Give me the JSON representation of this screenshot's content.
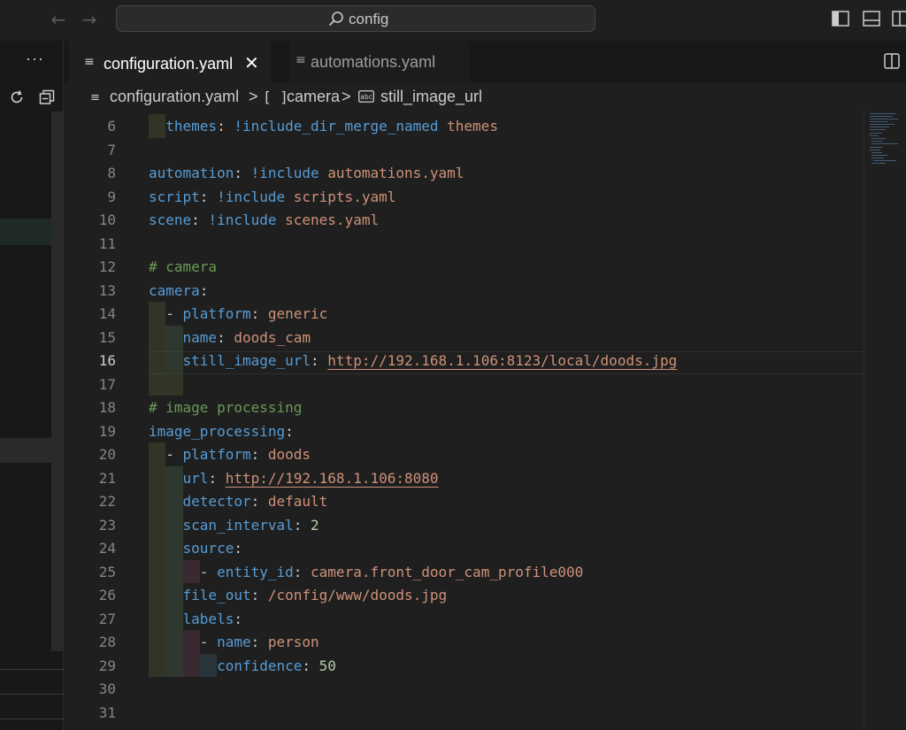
{
  "titlebar": {
    "search_text": "config",
    "back_icon": "arrow-left-icon",
    "forward_icon": "arrow-right-icon"
  },
  "sidebar": {
    "more_label": "···"
  },
  "tabs": [
    {
      "label": "configuration.yaml",
      "active": true,
      "icon": "file-lines-icon"
    },
    {
      "label": "automations.yaml",
      "active": false,
      "icon": "file-lines-icon"
    }
  ],
  "breadcrumb": {
    "file": "configuration.yaml",
    "sep1": ">",
    "bracket_icon": "[ ]",
    "section": "camera",
    "sep2": ">",
    "field": "still_image_url"
  },
  "editor": {
    "active_line": "16",
    "lines": [
      {
        "num": "6",
        "tokens": [
          {
            "t": "  ",
            "c": "w"
          },
          {
            "t": "themes",
            "c": "k"
          },
          {
            "t": ": ",
            "c": "w"
          },
          {
            "t": "!include_dir_merge_named",
            "c": "k"
          },
          {
            "t": " themes",
            "c": "s"
          }
        ]
      },
      {
        "num": "7",
        "tokens": []
      },
      {
        "num": "8",
        "tokens": [
          {
            "t": "automation",
            "c": "k"
          },
          {
            "t": ": ",
            "c": "w"
          },
          {
            "t": "!include",
            "c": "k"
          },
          {
            "t": " automations.yaml",
            "c": "s"
          }
        ]
      },
      {
        "num": "9",
        "tokens": [
          {
            "t": "script",
            "c": "k"
          },
          {
            "t": ": ",
            "c": "w"
          },
          {
            "t": "!include",
            "c": "k"
          },
          {
            "t": " scripts.yaml",
            "c": "s"
          }
        ]
      },
      {
        "num": "10",
        "tokens": [
          {
            "t": "scene",
            "c": "k"
          },
          {
            "t": ": ",
            "c": "w"
          },
          {
            "t": "!include",
            "c": "k"
          },
          {
            "t": " scenes.yaml",
            "c": "s"
          }
        ]
      },
      {
        "num": "11",
        "tokens": []
      },
      {
        "num": "12",
        "tokens": [
          {
            "t": "# camera",
            "c": "c"
          }
        ]
      },
      {
        "num": "13",
        "tokens": [
          {
            "t": "camera",
            "c": "k"
          },
          {
            "t": ":",
            "c": "w"
          }
        ]
      },
      {
        "num": "14",
        "tokens": [
          {
            "t": "  - ",
            "c": "w"
          },
          {
            "t": "platform",
            "c": "k"
          },
          {
            "t": ": ",
            "c": "w"
          },
          {
            "t": "generic",
            "c": "s"
          }
        ]
      },
      {
        "num": "15",
        "tokens": [
          {
            "t": "    ",
            "c": "w"
          },
          {
            "t": "name",
            "c": "k"
          },
          {
            "t": ": ",
            "c": "w"
          },
          {
            "t": "doods_cam",
            "c": "s"
          }
        ]
      },
      {
        "num": "16",
        "tokens": [
          {
            "t": "    ",
            "c": "w"
          },
          {
            "t": "still_image_url",
            "c": "k"
          },
          {
            "t": ": ",
            "c": "w"
          },
          {
            "t": "http://192.168.1.106:8123/local/doods.jpg",
            "c": "u"
          }
        ]
      },
      {
        "num": "17",
        "tokens": []
      },
      {
        "num": "18",
        "tokens": [
          {
            "t": "# image processing",
            "c": "c"
          }
        ]
      },
      {
        "num": "19",
        "tokens": [
          {
            "t": "image_processing",
            "c": "k"
          },
          {
            "t": ":",
            "c": "w"
          }
        ]
      },
      {
        "num": "20",
        "tokens": [
          {
            "t": "  - ",
            "c": "w"
          },
          {
            "t": "platform",
            "c": "k"
          },
          {
            "t": ": ",
            "c": "w"
          },
          {
            "t": "doods",
            "c": "s"
          }
        ]
      },
      {
        "num": "21",
        "tokens": [
          {
            "t": "    ",
            "c": "w"
          },
          {
            "t": "url",
            "c": "k"
          },
          {
            "t": ": ",
            "c": "w"
          },
          {
            "t": "http://192.168.1.106:8080",
            "c": "u"
          }
        ]
      },
      {
        "num": "22",
        "tokens": [
          {
            "t": "    ",
            "c": "w"
          },
          {
            "t": "detector",
            "c": "k"
          },
          {
            "t": ": ",
            "c": "w"
          },
          {
            "t": "default",
            "c": "s"
          }
        ]
      },
      {
        "num": "23",
        "tokens": [
          {
            "t": "    ",
            "c": "w"
          },
          {
            "t": "scan_interval",
            "c": "k"
          },
          {
            "t": ": ",
            "c": "w"
          },
          {
            "t": "2",
            "c": "n"
          }
        ]
      },
      {
        "num": "24",
        "tokens": [
          {
            "t": "    ",
            "c": "w"
          },
          {
            "t": "source",
            "c": "k"
          },
          {
            "t": ":",
            "c": "w"
          }
        ]
      },
      {
        "num": "25",
        "tokens": [
          {
            "t": "      - ",
            "c": "w"
          },
          {
            "t": "entity_id",
            "c": "k"
          },
          {
            "t": ": ",
            "c": "w"
          },
          {
            "t": "camera.front_door_cam_profile000",
            "c": "s"
          }
        ]
      },
      {
        "num": "26",
        "tokens": [
          {
            "t": "    ",
            "c": "w"
          },
          {
            "t": "file_out",
            "c": "k"
          },
          {
            "t": ": ",
            "c": "w"
          },
          {
            "t": "/config/www/doods.jpg",
            "c": "s"
          }
        ]
      },
      {
        "num": "27",
        "tokens": [
          {
            "t": "    ",
            "c": "w"
          },
          {
            "t": "labels",
            "c": "k"
          },
          {
            "t": ":",
            "c": "w"
          }
        ]
      },
      {
        "num": "28",
        "tokens": [
          {
            "t": "      - ",
            "c": "w"
          },
          {
            "t": "name",
            "c": "k"
          },
          {
            "t": ": ",
            "c": "w"
          },
          {
            "t": "person",
            "c": "s"
          }
        ]
      },
      {
        "num": "29",
        "tokens": [
          {
            "t": "        ",
            "c": "w"
          },
          {
            "t": "confidence",
            "c": "k"
          },
          {
            "t": ": ",
            "c": "w"
          },
          {
            "t": "50",
            "c": "n"
          }
        ]
      },
      {
        "num": "30",
        "tokens": []
      },
      {
        "num": "31",
        "tokens": []
      }
    ]
  },
  "colors": {
    "keyword": "#569cd6",
    "string": "#ce9178",
    "comment": "#6a9955",
    "number": "#b5cea8",
    "background": "#1f1f1f"
  }
}
